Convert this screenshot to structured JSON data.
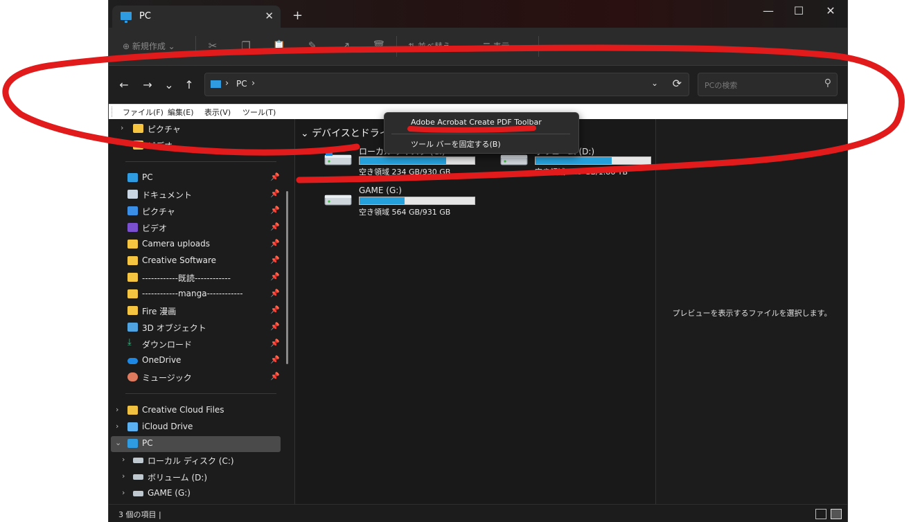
{
  "window": {
    "tab_title": "PC",
    "tab_close": "✕",
    "new_tab": "+",
    "minimize": "—",
    "maximize": "☐",
    "close": "✕"
  },
  "toolbar": {
    "new_label": "⊕ 新規作成 ⌄",
    "sort_label": "⇅ 並べ替え ⌄",
    "view_label": "☰ 表示 ⌄"
  },
  "nav": {
    "back": "←",
    "forward": "→",
    "recent": "⌄",
    "up": "↑",
    "address_sep": "›",
    "address_label": "PC",
    "address_dropdown": "⌄",
    "refresh": "⟳",
    "search_placeholder": "PCの検索",
    "search_icon": "⚲"
  },
  "menubar": {
    "file": "ファイル(F)",
    "edit": "編集(E)",
    "view": "表示(V)",
    "tools": "ツール(T)"
  },
  "sidebar": {
    "top_items": [
      {
        "label": "ピクチャ",
        "icon": "folder-icon"
      },
      {
        "label": "ビデオ",
        "icon": "folder-icon"
      }
    ],
    "quick_access": [
      {
        "label": "PC",
        "icon": "pc-icon"
      },
      {
        "label": "ドキュメント",
        "icon": "document-icon"
      },
      {
        "label": "ピクチャ",
        "icon": "pictures-icon"
      },
      {
        "label": "ビデオ",
        "icon": "video-icon"
      },
      {
        "label": "Camera uploads",
        "icon": "folder-icon"
      },
      {
        "label": "Creative Software",
        "icon": "folder-icon"
      },
      {
        "label": "------------既読------------",
        "icon": "folder-icon"
      },
      {
        "label": "------------manga------------",
        "icon": "folder-icon"
      },
      {
        "label": "Fire 漫画",
        "icon": "folder-icon"
      },
      {
        "label": "3D オブジェクト",
        "icon": "3d-objects-icon"
      },
      {
        "label": "ダウンロード",
        "icon": "download-icon"
      },
      {
        "label": "OneDrive",
        "icon": "onedrive-icon"
      },
      {
        "label": "ミュージック",
        "icon": "music-icon"
      }
    ],
    "locations": [
      {
        "label": "Creative Cloud Files",
        "icon": "creative-cloud-icon"
      },
      {
        "label": "iCloud Drive",
        "icon": "icloud-icon"
      },
      {
        "label": "PC",
        "icon": "pc-icon"
      }
    ],
    "drives": [
      {
        "label": "ローカル ディスク (C:)"
      },
      {
        "label": "ボリューム (D:)"
      },
      {
        "label": "GAME (G:)"
      }
    ],
    "pin_glyph": "📌"
  },
  "content": {
    "group_label": "デバイスとドライブ",
    "group_chevron": "⌄",
    "drives": [
      {
        "name": "ローカル ディスク (C:)",
        "free_text": "空き領域 234 GB/930 GB",
        "used_fraction": 0.75
      },
      {
        "name": "ボリューム (D:)",
        "free_text": "空き領域 625 GB/1.86 TB",
        "used_fraction": 0.66
      },
      {
        "name": "GAME (G:)",
        "free_text": "空き領域 564 GB/931 GB",
        "used_fraction": 0.39
      }
    ]
  },
  "context_menu": {
    "item1": "Adobe Acrobat Create PDF Toolbar",
    "item2": "ツール バーを固定する(B)"
  },
  "preview": {
    "message": "プレビューを表示するファイルを選択します。"
  },
  "status": {
    "count": "3 個の項目  |"
  },
  "colors": {
    "accent": "#26a0da",
    "annotation": "#e11b1b",
    "folder": "#f5c542"
  }
}
